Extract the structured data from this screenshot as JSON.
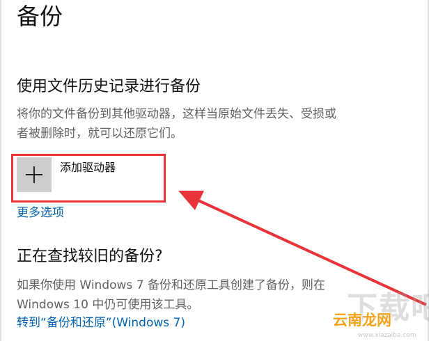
{
  "page": {
    "title": "备份"
  },
  "file_history": {
    "heading": "使用文件历史记录进行备份",
    "description_line1": "将你的文件备份到其他驱动器，这样当原始文件丢失、受损或",
    "description_line2": "者被删除时，就可以还原它们。",
    "add_drive_label": "添加驱动器",
    "more_options_label": "更多选项"
  },
  "older_backup": {
    "heading": "正在查找较旧的备份?",
    "description_line1": "如果你使用 Windows 7 备份和还原工具创建了备份，则在",
    "description_line2": "Windows 10 中仍可使用该工具。",
    "restore_link_label": "转到“备份和还原”(Windows 7)"
  },
  "watermark": {
    "big_text": "下载吧",
    "brand": "云南龙网",
    "url": "www.xiazaiba.com"
  },
  "colors": {
    "accent_link": "#0063b1",
    "annotation_red": "#e8343a",
    "tile_gray": "#cccccc",
    "description_gray": "#616161"
  },
  "icons": {
    "add_drive": "plus-icon",
    "annotation": "red-arrow-icon"
  }
}
